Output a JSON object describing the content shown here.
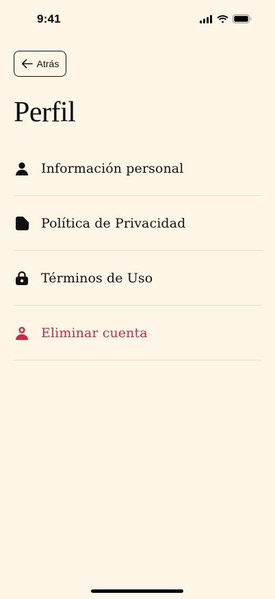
{
  "status_bar": {
    "time": "9:41"
  },
  "header": {
    "back_label": "Atrás",
    "title": "Perfil"
  },
  "menu": {
    "items": [
      {
        "label": "Información personal",
        "icon": "person-icon"
      },
      {
        "label": "Política de Privacidad",
        "icon": "document-icon"
      },
      {
        "label": "Términos de Uso",
        "icon": "lock-icon"
      },
      {
        "label": "Eliminar cuenta",
        "icon": "delete-account-icon"
      }
    ]
  },
  "colors": {
    "background": "#FDF6E7",
    "text": "#111111",
    "danger": "#D4244A",
    "divider": "#E8E1D0"
  }
}
